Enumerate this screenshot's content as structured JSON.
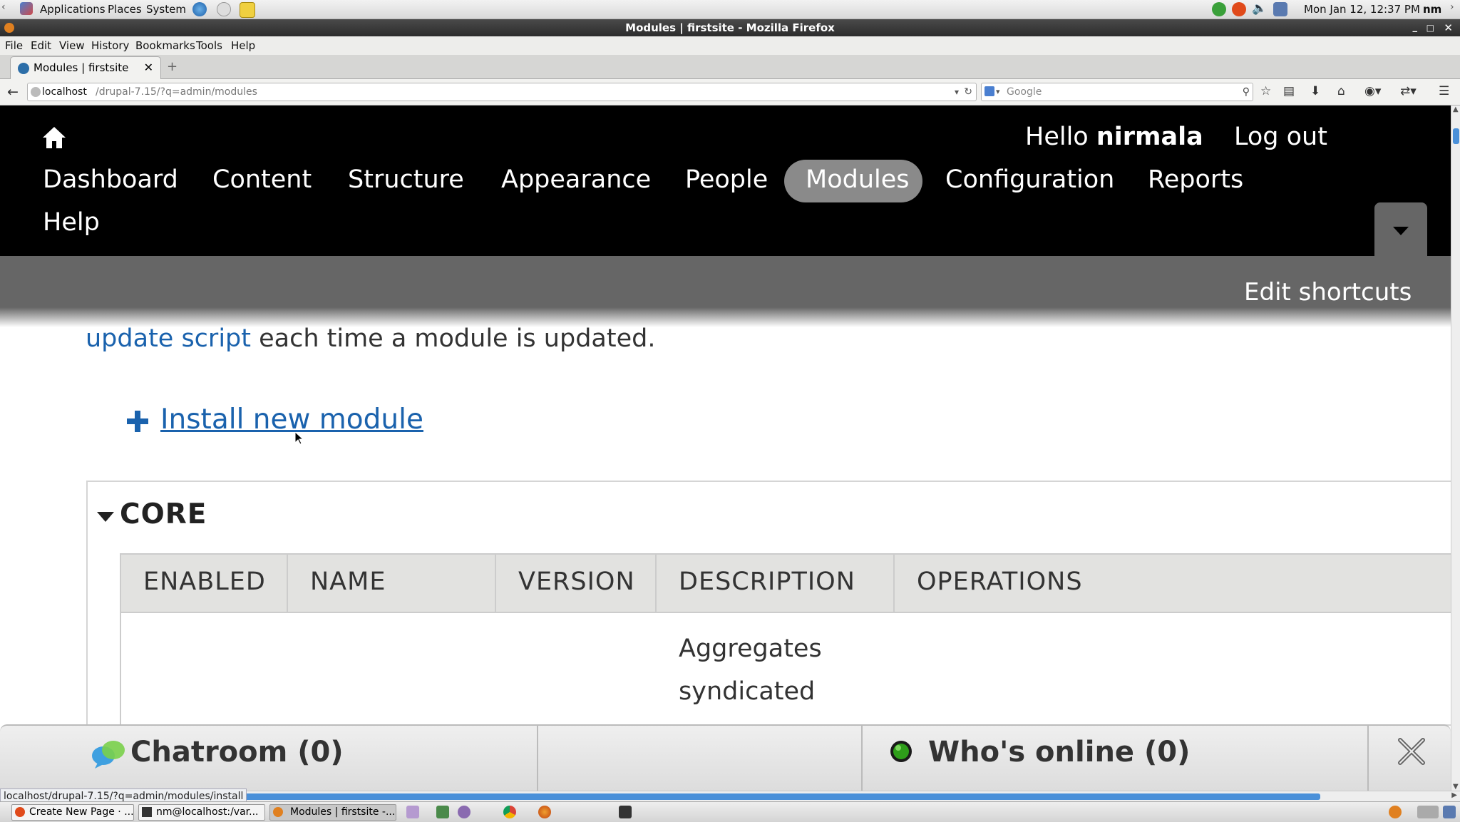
{
  "gnome_panel": {
    "menus": [
      "Applications",
      "Places",
      "System"
    ],
    "clock": "Mon Jan 12, 12:37 PM",
    "user": "nm"
  },
  "window": {
    "title": "Modules | firstsite - Mozilla Firefox"
  },
  "menubar": [
    "File",
    "Edit",
    "View",
    "History",
    "Bookmarks",
    "Tools",
    "Help"
  ],
  "tab": {
    "label": "Modules | firstsite"
  },
  "navbar": {
    "url_host": "localhost",
    "url_path": "/drupal-7.15/?q=admin/modules",
    "search_engine_placeholder": "Google"
  },
  "toolbar": {
    "greeting": "Hello",
    "username": "nirmala",
    "logout": "Log out",
    "nav": [
      "Dashboard",
      "Content",
      "Structure",
      "Appearance",
      "People",
      "Modules",
      "Configuration",
      "Reports",
      "Help"
    ],
    "active": "Modules",
    "edit_shortcuts": "Edit shortcuts"
  },
  "content": {
    "update_link": "update script",
    "update_text": " each time a module is updated.",
    "install_link": "Install new module",
    "fieldset_title": "CORE",
    "table_headers": [
      "ENABLED",
      "NAME",
      "VERSION",
      "DESCRIPTION",
      "OPERATIONS"
    ],
    "first_row_description": [
      "Aggregates",
      "syndicated"
    ]
  },
  "chatbar": {
    "chatroom": "Chatroom (0)",
    "whos_online": "Who's online (0)",
    "online_status_color": "#2e9e1a"
  },
  "status_bar": {
    "link": "localhost/drupal-7.15/?q=admin/modules/install"
  },
  "taskbar": {
    "buttons": [
      "Create New Page · ...",
      "nm@localhost:/var...",
      "Modules | firstsite -..."
    ]
  },
  "colors": {
    "link": "#1a62ad",
    "toolbar_bg": "#000000",
    "active_pill": "#8a8a8a"
  }
}
